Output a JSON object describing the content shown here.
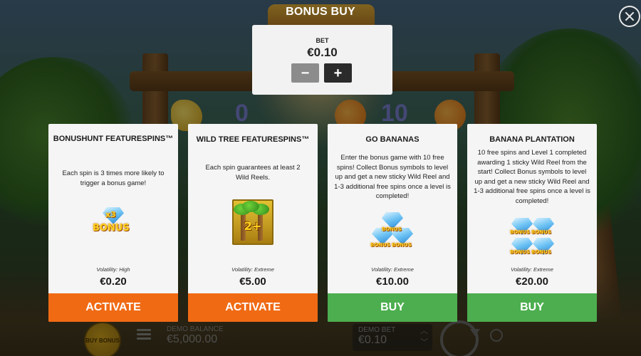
{
  "modal": {
    "title": "BONUS BUY",
    "close_icon": "close-icon"
  },
  "bet": {
    "label": "BET",
    "value": "€0.10",
    "minus": "−",
    "plus": "+"
  },
  "cards": [
    {
      "title": "BONUSHUNT FEATURESPINS™",
      "description": "Each spin is 3 times more likely to trigger a bonus game!",
      "icon": "x3-bonus-icon",
      "icon_text": [
        "x3",
        "BONUS"
      ],
      "volatility": "Volatility: High",
      "price": "€0.20",
      "action": "ACTIVATE",
      "action_color": "#f06a14"
    },
    {
      "title": "WILD TREE FEATURESPINS™",
      "description": "Each spin guarantees at least 2 Wild Reels.",
      "icon": "wild-tree-icon",
      "icon_text": "2+",
      "volatility": "Volatility: Extreme",
      "price": "€5.00",
      "action": "ACTIVATE",
      "action_color": "#f06a14"
    },
    {
      "title": "GO BANANAS",
      "description": "Enter the bonus game with 10 free spins! Collect Bonus symbols to level up and get a new sticky Wild Reel and 1-3 additional free spins once a level is completed!",
      "icon": "bonus-diamonds-icon",
      "icon_text": [
        "BONUS",
        "BONUS",
        "BONUS"
      ],
      "volatility": "Volatility: Extreme",
      "price": "€10.00",
      "action": "BUY",
      "action_color": "#4cae4f"
    },
    {
      "title": "BANANA PLANTATION",
      "description": "10 free spins and Level 1 completed awarding 1 sticky Wild Reel from the start! Collect Bonus symbols to level up and get a new sticky Wild Reel and 1-3 additional free spins once a level is completed!",
      "icon": "bonus-diamonds-icon",
      "icon_text": [
        "BONUS",
        "BONUS",
        "BONUS",
        "BONUS"
      ],
      "volatility": "Volatility: Extreme",
      "price": "€20.00",
      "action": "BUY",
      "action_color": "#4cae4f"
    }
  ],
  "game_bar": {
    "buy_bonus_label": "BUY BONUS",
    "demo_balance_label": "DEMO BALANCE",
    "demo_balance_value": "€5,000.00",
    "demo_bet_label": "DEMO BET",
    "demo_bet_value": "€0.10",
    "icons": [
      "menu-icon",
      "spin-icon",
      "autoplay-icon",
      "chevron-up-icon",
      "chevron-down-icon"
    ]
  },
  "background": {
    "reel_symbols": [
      "0",
      "10"
    ]
  }
}
